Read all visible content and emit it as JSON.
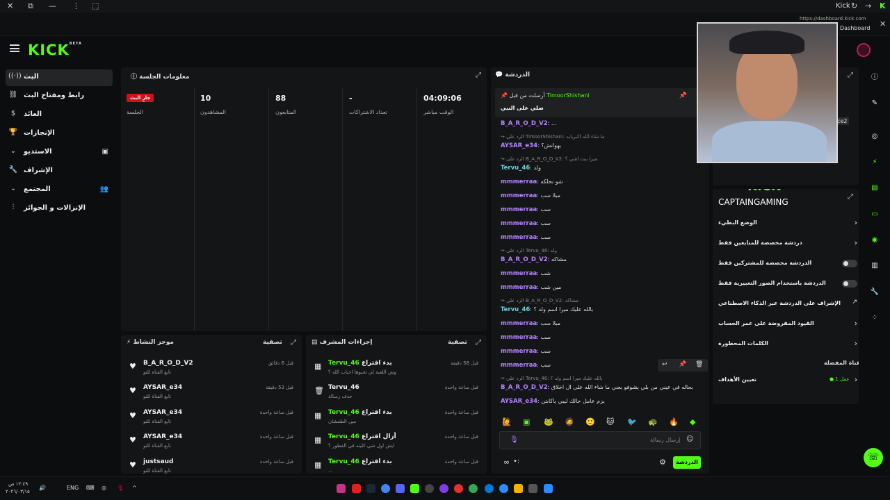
{
  "browser": {
    "tab_label": "Kick",
    "url": "https://dashboard.kick.com",
    "tooltip": "Dashboard"
  },
  "brand": {
    "logo": "KICK",
    "logo_sup": "BETA",
    "accent": "#53fc18"
  },
  "nav": {
    "items": [
      {
        "label": "البث",
        "icon": "broadcast-icon"
      },
      {
        "label": "رابط ومفتاح البث",
        "icon": "link-icon"
      },
      {
        "label": "العائد",
        "icon": "dollar-icon"
      },
      {
        "label": "الإنجازات",
        "icon": "trophy-icon"
      },
      {
        "label": "الاستديو",
        "icon": "chevron-down-icon"
      },
      {
        "label": "الإشراف",
        "icon": "wrench-icon"
      },
      {
        "label": "المجتمع",
        "icon": "chevron-down-icon"
      },
      {
        "label": "الإنزالات و الجوائز",
        "icon": "drops-icon"
      }
    ]
  },
  "session": {
    "title": "معلومات الجلسة",
    "live_badge": "جارٍ البث",
    "session_label": "الجلسة",
    "viewers_value": "10",
    "viewers_label": "المشاهدون",
    "followers_value": "88",
    "followers_label": "المتابعون",
    "subs_value": "-",
    "subs_label": "تعداد الاشتراكات",
    "uptime_value": "04:09:06",
    "uptime_label": "الوقت مباشر"
  },
  "activity": {
    "title": "موجز النشاط",
    "filter": "تصفية",
    "rows": [
      {
        "name": "B_A_R_O_D_V2",
        "sub": "تابع القناة للتو",
        "time": "قبل 6 دقائق"
      },
      {
        "name": "AYSAR_e34",
        "sub": "تابع القناة للتو",
        "time": "قبل 53 دقيقة"
      },
      {
        "name": "AYSAR_e34",
        "sub": "تابع القناة للتو",
        "time": "قبل ساعة واحدة"
      },
      {
        "name": "AYSAR_e34",
        "sub": "تابع القناة للتو",
        "time": "قبل ساعة واحدة"
      },
      {
        "name": "justsaud",
        "sub": "تابع القناة للتو",
        "time": "قبل ساعة واحدة"
      }
    ]
  },
  "modactions": {
    "title": "إجراءات المشرف",
    "filter": "تصفية",
    "rows": [
      {
        "user": "Tervu_46",
        "action": "بدء اقتراع",
        "sub": "وش اللعبة لي تحبوها احباب الله ؟",
        "time": "قبل 58 دقيقة"
      },
      {
        "user": "Tervu_46",
        "action": "",
        "sub": "حذف رسالة",
        "time": "قبل ساعة واحدة"
      },
      {
        "user": "Tervu_46",
        "action": "بدء اقتراع",
        "sub": "مين الطفشان",
        "time": "قبل ساعة واحدة"
      },
      {
        "user": "Tervu_46",
        "action": "أزال اقتراع",
        "sub": "ايش اول شي كليته في الفطور ؟",
        "time": "قبل ساعة واحدة"
      },
      {
        "user": "Tervu_46",
        "action": "بدء اقتراع",
        "sub": "...",
        "time": "قبل ساعة واحدة"
      }
    ]
  },
  "chat": {
    "title": "الدردشة",
    "pinned_by_label": "أرسلت من قبل",
    "pinned_user": "TimoorShishani",
    "pinned_msg": "صلي على النبي",
    "lines": [
      {
        "type": "user",
        "user": "B_A_R_O_D_V2",
        "color": "purple",
        "msg": ": ..."
      },
      {
        "type": "reply",
        "text": "الرد على TimoorShishani: ما شاء الله اكبربابه"
      },
      {
        "type": "user",
        "user": "AYSAR_e34",
        "color": "purple",
        "msg": ": بهوانش؟"
      },
      {
        "type": "reply",
        "text": "الرد على B_A_R_O_D_V2: ميرا بنت اشي ؟"
      },
      {
        "type": "user",
        "user": "Tervu_46",
        "color": "teal",
        "msg": ": ولد"
      },
      {
        "type": "user",
        "user": "mmmerraa",
        "color": "purple",
        "msg": ": شو نحلكه"
      },
      {
        "type": "user",
        "user": "mmmerraa",
        "color": "purple",
        "msg": ": مبلا سب"
      },
      {
        "type": "user",
        "user": "mmmerraa",
        "color": "purple",
        "msg": ": سب"
      },
      {
        "type": "user",
        "user": "mmmerraa",
        "color": "purple",
        "msg": ": سب"
      },
      {
        "type": "user",
        "user": "mmmerraa",
        "color": "purple",
        "msg": ": سب"
      },
      {
        "type": "reply",
        "text": "الرد على Tervu_46: ولد"
      },
      {
        "type": "user",
        "user": "B_A_R_O_D_V2",
        "color": "purple",
        "msg": ": مشاكه"
      },
      {
        "type": "user",
        "user": "mmmerraa",
        "color": "purple",
        "msg": ": شب"
      },
      {
        "type": "user",
        "user": "mmmerraa",
        "color": "purple",
        "msg": ": مين شب"
      },
      {
        "type": "reply",
        "text": "الرد على B_A_R_O_D_V2: مشاكه"
      },
      {
        "type": "user",
        "user": "Tervu_46",
        "color": "teal",
        "msg": ": بالله عليك ميرا اسم ولد ؟"
      },
      {
        "type": "user",
        "user": "mmmerraa",
        "color": "purple",
        "msg": ": مبلا سب"
      },
      {
        "type": "user",
        "user": "mmmerraa",
        "color": "purple",
        "msg": ": سب"
      },
      {
        "type": "user",
        "user": "mmmerraa",
        "color": "purple",
        "msg": ": سب"
      },
      {
        "type": "user",
        "user": "mmmerraa",
        "color": "purple",
        "msg": ": سب"
      },
      {
        "type": "reply",
        "text": "الرد على Tervu_46: بالله عليك ميرا اسم ولد ؟"
      },
      {
        "type": "user",
        "user": "B_A_R_O_D_V2",
        "color": "purple",
        "msg": ": لا لان بحاله في عيني من بلي يشوفو يعني ما شاء الله على ال اخلاق"
      },
      {
        "type": "user",
        "user": "AYSAR_e34",
        "color": "purple",
        "msg": ": يزم عامل حالك ليبي ياكابتن"
      }
    ],
    "input_placeholder": "إرسال رسالة",
    "send_label": "الدردشة"
  },
  "modsettings": {
    "title": "إعدادات الدردشة",
    "channel_overlay": "CAPTAINGAMING",
    "rows": [
      {
        "label": "الوضع البطيء",
        "kind": "chevron"
      },
      {
        "label": "دردشة مخصصة للمتابعين فقط",
        "kind": "chevron"
      },
      {
        "label": "الدردشة مخصصة للمشتركين فقط",
        "kind": "toggle"
      },
      {
        "label": "الدردشة باستخدام الصور التعبيرية فقط",
        "kind": "toggle"
      },
      {
        "label": "الإشراف على الدردشة عبر الذكاء الاصطناعي",
        "kind": "external"
      },
      {
        "label": "القيود المفروضة على عمر الحساب",
        "kind": "chevron"
      },
      {
        "label": "الكلمات المحظورة",
        "kind": "chevron"
      }
    ],
    "fav_channel_label": "القناة المفضلة",
    "goals_label": "تعيين الأهداف",
    "goals_value": "عمل 1"
  },
  "taskbar": {
    "time": "١٢:٤٩ ص",
    "date": "٢٠٢٦/٠٣/١٥",
    "lang": "ENG"
  }
}
